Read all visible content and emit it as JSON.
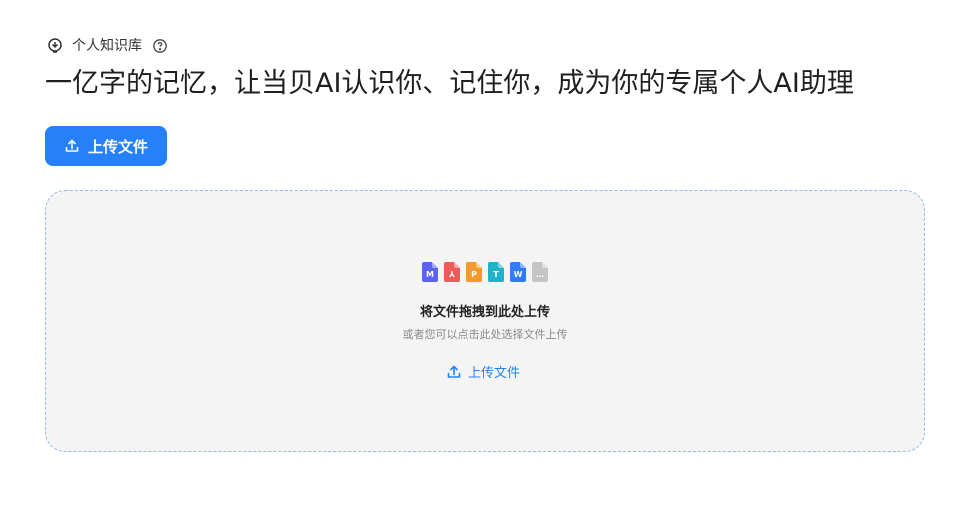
{
  "header": {
    "icon": "lightbulb-icon",
    "label": "个人知识库",
    "help_icon": "question-circle-icon"
  },
  "title": "一亿字的记忆，让当贝AI认识你、记住你，成为你的专属个人AI助理",
  "upload_button": {
    "icon": "upload-icon",
    "label": "上传文件"
  },
  "dropzone": {
    "file_types": [
      {
        "icon": "markdown-file-icon",
        "letter": "M",
        "color": "#5b63f0"
      },
      {
        "icon": "pdf-file-icon",
        "letter": "⅄",
        "color": "#ef5a5a"
      },
      {
        "icon": "ppt-file-icon",
        "letter": "P",
        "color": "#f39a2b"
      },
      {
        "icon": "txt-file-icon",
        "letter": "T",
        "color": "#1fb2c9"
      },
      {
        "icon": "word-file-icon",
        "letter": "W",
        "color": "#2f7cf6"
      },
      {
        "icon": "more-file-icon",
        "letter": "…",
        "color": "#c4c4c4"
      }
    ],
    "title": "将文件拖拽到此处上传",
    "subtitle": "或者您可以点击此处选择文件上传",
    "link_icon": "upload-icon",
    "link_label": "上传文件"
  },
  "colors": {
    "accent": "#2680f8",
    "dropzone_bg": "#f4f4f5",
    "dropzone_border": "#94b9ee"
  }
}
